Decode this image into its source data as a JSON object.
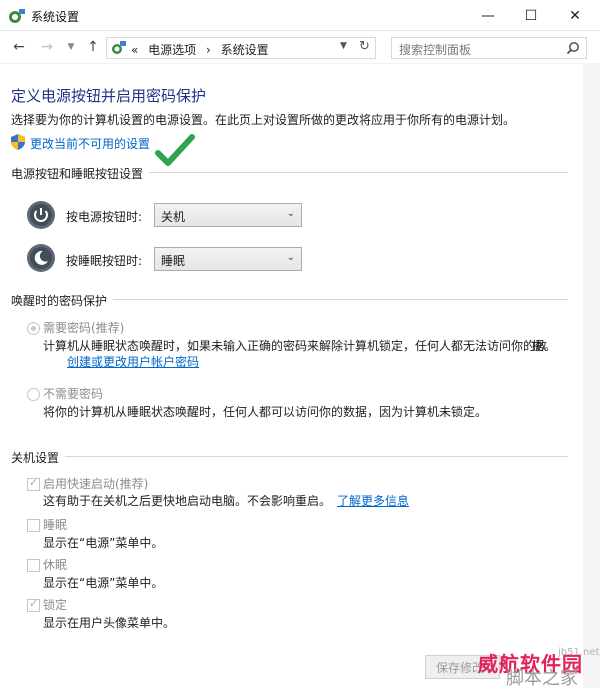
{
  "window": {
    "title": "系统设置"
  },
  "nav": {
    "breadcrumb_prefix": "«",
    "crumb1": "电源选项",
    "separator": "›",
    "crumb2": "系统设置",
    "search_placeholder": "搜索控制面板"
  },
  "header": {
    "title": "定义电源按钮并启用密码保护",
    "description": "选择要为你的计算机设置的电源设置。在此页上对设置所做的更改将应用于你所有的电源计划。",
    "change_link": "更改当前不可用的设置"
  },
  "power_section": {
    "title": "电源按钮和睡眠按钮设置",
    "power_label": "按电源按钮时:",
    "power_value": "关机",
    "sleep_label": "按睡眠按钮时:",
    "sleep_value": "睡眠"
  },
  "wake_section": {
    "title": "唤醒时的密码保护",
    "opt1_label": "需要密码(推荐)",
    "opt1_desc": "计算机从睡眠状态唤醒时，如果未输入正确的密码来解除计算机锁定，任何人都无法访问你的数",
    "opt1_desc2": "据。",
    "opt1_link": "创建或更改用户帐户密码",
    "opt1_checked": true,
    "opt2_label": "不需要密码",
    "opt2_desc": "将你的计算机从睡眠状态唤醒时，任何人都可以访问你的数据，因为计算机未锁定。",
    "opt2_checked": false
  },
  "shutdown_section": {
    "title": "关机设置",
    "items": [
      {
        "label": "启用快速启动(推荐)",
        "desc": "这有助于在关机之后更快地启动电脑。不会影响重启。",
        "link": "了解更多信息",
        "checked": true
      },
      {
        "label": "睡眠",
        "desc": "显示在“电源”菜单中。",
        "checked": false
      },
      {
        "label": "休眠",
        "desc": "显示在“电源”菜单中。",
        "checked": false
      },
      {
        "label": "锁定",
        "desc": "显示在用户头像菜单中。",
        "checked": true
      }
    ]
  },
  "footer": {
    "save_label": "保存修改"
  },
  "watermark": {
    "line1": "威航软件园",
    "site": "jb51.net",
    "line2": "脚本之家"
  },
  "colors": {
    "heading": "#1e3287",
    "link": "#0066cc",
    "watermark": "#e0245a"
  }
}
